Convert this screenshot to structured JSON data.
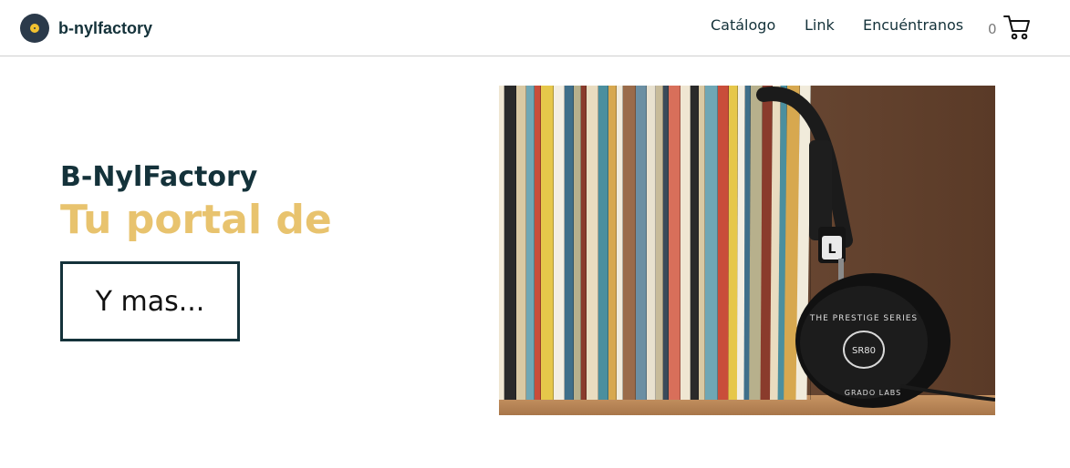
{
  "navbar": {
    "brand": "b-nylfactory",
    "links": [
      "Catálogo",
      "Link",
      "Encuéntranos"
    ],
    "cart_count": "0"
  },
  "hero": {
    "subtitle": "B-NylFactory",
    "title": "Tu portal de",
    "button_label": "Y mas..."
  },
  "image": {
    "headphones_text_top": "THE PRESTIGE SERIES",
    "headphones_model": "SR80",
    "headphones_brand": "GRADO LABS",
    "headphones_badge": "L"
  },
  "colors": {
    "primary": "#14323a",
    "accent": "#e8c36e",
    "logo_dark": "#2b3a4a",
    "logo_yellow": "#f2c230"
  },
  "icons": [
    "logo-icon",
    "cart-icon"
  ]
}
